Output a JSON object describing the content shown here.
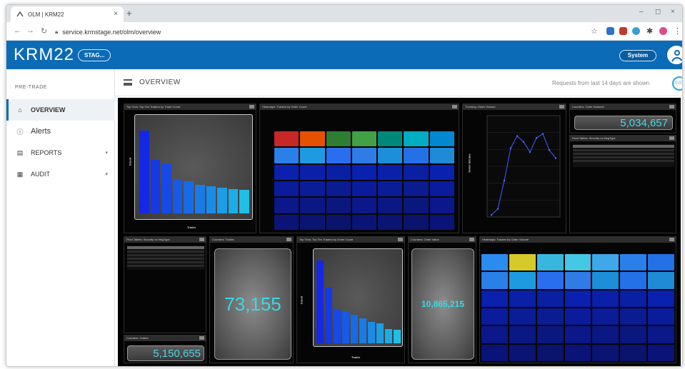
{
  "browser": {
    "tab_title": "OLM | KRM22",
    "new_tab": "+",
    "close": "×",
    "url": "service.krmstage.net/olm/overview",
    "min": "–",
    "max": "◻",
    "winclose": "×"
  },
  "app": {
    "brand": "KRM22",
    "env_button": "STAG...",
    "system_button": "System"
  },
  "sidebar": {
    "section": "PRE-TRADE",
    "items": [
      {
        "label": "OVERVIEW",
        "icon": "home-icon",
        "active": true
      },
      {
        "label": "Alerts",
        "icon": "alert-circle-icon",
        "active": false
      },
      {
        "label": "REPORTS",
        "icon": "document-icon",
        "active": false,
        "chevron": "▾"
      },
      {
        "label": "AUDIT",
        "icon": "calendar-icon",
        "active": false,
        "chevron": "▾"
      }
    ]
  },
  "page": {
    "title": "OVERVIEW",
    "requests_note": "Requests from last 14 days are shown",
    "requests_badge": "0.07"
  },
  "panels": {
    "p1": {
      "title": "Top Tens: Top Ten Traders by Trade Count",
      "xlabel": "Trader",
      "ylabel": "Count"
    },
    "p2": {
      "title": "Heatmaps: Traders by Order Count"
    },
    "p3": {
      "title": "Trending: Order Volume",
      "ylabel": "Order Volume"
    },
    "p4": {
      "title": "Counters: Order Notional",
      "value": "5,034,657"
    },
    "p5": {
      "title": "Pivot Tables: Security vs MsgType"
    },
    "p6": {
      "title": "Pivot Tables: Security vs MsgType"
    },
    "p7": {
      "title": "Counters: Trades",
      "value": "73,155"
    },
    "p8": {
      "title": "Top Tens: Top Ten Traders by Order Count",
      "xlabel": "Trader",
      "ylabel": "Count"
    },
    "p9": {
      "title": "Counters: Order Value",
      "value": "10,865,215"
    },
    "p10": {
      "title": "Heatmaps: Traders by Order Volume"
    },
    "p11": {
      "title": "Counters: Orders",
      "value": "5,150,655"
    }
  },
  "colors": {
    "header_blue": "#0b6bb7",
    "metric_cyan": "#39d8e6"
  },
  "chart_data": [
    {
      "type": "bar",
      "title": "Top Tens: Top Ten Traders by Trade Count",
      "xlabel": "Trader",
      "ylabel": "Count",
      "values": [
        88,
        57,
        53,
        36,
        34,
        30,
        29,
        27,
        26,
        25
      ]
    },
    {
      "type": "line",
      "title": "Trending: Order Volume",
      "ylabel": "Order Volume",
      "values": [
        2,
        8,
        36,
        68,
        80,
        74,
        64,
        78,
        82,
        66,
        58
      ]
    },
    {
      "type": "bar",
      "title": "Top Tens: Top Ten Traders by Order Count",
      "xlabel": "Trader",
      "ylabel": "Count",
      "values": [
        92,
        62,
        38,
        36,
        32,
        28,
        24,
        22,
        16,
        15
      ]
    },
    {
      "type": "heatmap",
      "title": "Heatmaps: Traders by Order Count",
      "rows": 6,
      "cols": 7
    },
    {
      "type": "heatmap",
      "title": "Heatmaps: Traders by Order Volume",
      "rows": 6,
      "cols": 7
    }
  ]
}
